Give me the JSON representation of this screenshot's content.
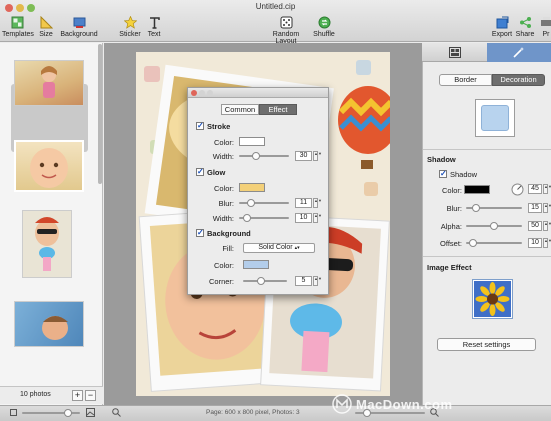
{
  "window": {
    "title": "Untitled.cip"
  },
  "toolbar": {
    "templates": "Templates",
    "size": "Size",
    "background": "Background",
    "sticker": "Sticker",
    "text": "Text",
    "random_layout": "Random Layout",
    "shuffle": "Shuffle",
    "export": "Export",
    "share": "Share",
    "print": "Pr"
  },
  "sidebar": {
    "photo_count": "10 photos",
    "add": "+",
    "remove": "−"
  },
  "dialog": {
    "tabs": [
      "Common",
      "Effect"
    ],
    "selected_tab": "Effect",
    "stroke": {
      "label": "Stroke",
      "checked": true,
      "color_label": "Color:",
      "color": "#ffffff",
      "width_label": "Width:",
      "width": "30",
      "width_fraction": 0.3
    },
    "glow": {
      "label": "Glow",
      "checked": true,
      "color_label": "Color:",
      "color": "#f3d079",
      "blur_label": "Blur:",
      "blur": "11",
      "blur_fraction": 0.18,
      "width_label": "Width:",
      "width": "10",
      "width_fraction": 0.1
    },
    "background": {
      "label": "Background",
      "checked": true,
      "fill_label": "Fill:",
      "fill": "Solid Color",
      "color_label": "Color:",
      "color": "#b3cdea",
      "corner_label": "Corner:",
      "corner": "5",
      "corner_fraction": 0.4
    }
  },
  "right_panel": {
    "tabs": [
      "Border",
      "Decoration"
    ],
    "selected_tab": "Decoration",
    "shadow": {
      "title": "Shadow",
      "checkbox_label": "Shadow",
      "checked": true,
      "color_label": "Color:",
      "color": "#000000",
      "angle": "45",
      "blur_label": "Blur:",
      "blur": "15",
      "alpha_label": "Alpha:",
      "alpha": "50",
      "offset_label": "Offset:",
      "offset": "10"
    },
    "image_effect": {
      "title": "Image Effect"
    },
    "reset_button": "Reset settings"
  },
  "status": {
    "page_info": "Page: 600 x 800 pixel, Photos: 3"
  },
  "watermark": "MacDown.com",
  "accent_color": "#6f95c9"
}
